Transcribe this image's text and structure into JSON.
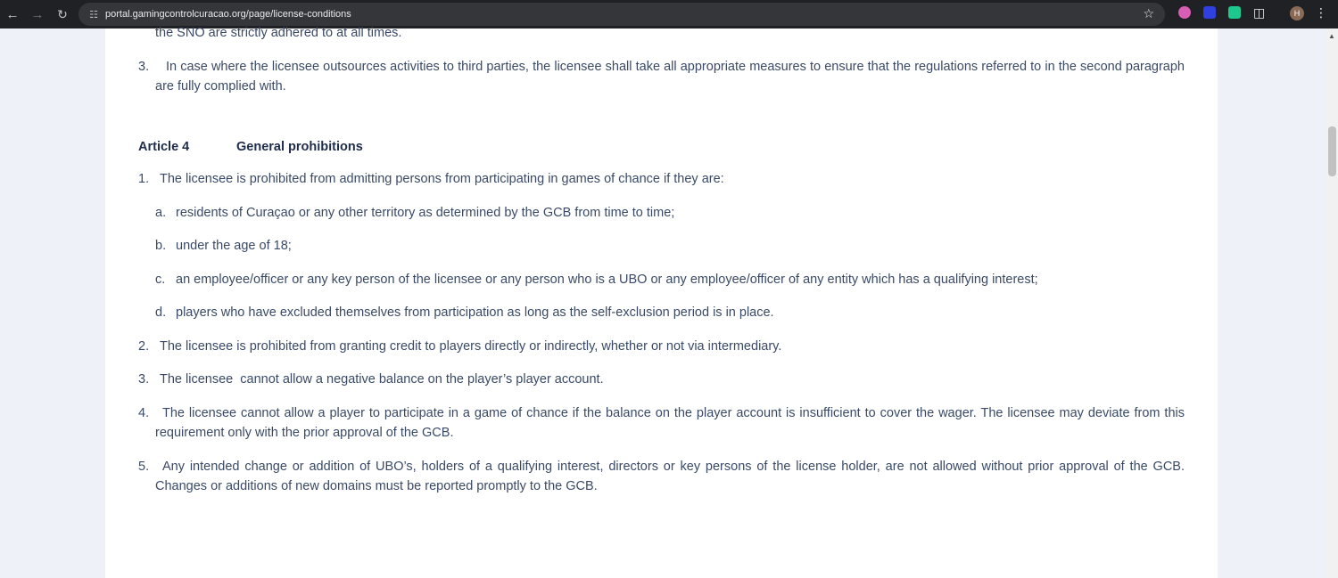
{
  "browser": {
    "url": "portal.gamingcontrolcuracao.org/page/license-conditions",
    "profile_initial": "H"
  },
  "content": {
    "prev_line": "the SNO are strictly adhered to at all times.",
    "prev_item": {
      "number": "3.",
      "text": "In case where the licensee outsources activities to third parties, the licensee shall take all appropriate measures to ensure that the regulations referred to in the second paragraph are fully complied with."
    },
    "article": {
      "number": "Article 4",
      "title": "General prohibitions"
    },
    "items": [
      {
        "number": "1.",
        "text": "The licensee is prohibited from admitting persons from participating in games of chance if they are:"
      },
      {
        "number": "2.",
        "text": "The licensee is prohibited from granting credit to players directly or indirectly, whether or not via intermediary."
      },
      {
        "number": "3.",
        "text": "The licensee  cannot allow a negative balance on the player’s player account."
      },
      {
        "number": "4.",
        "text": "The licensee cannot allow a player to participate in a game of chance if the balance on the player account is insufficient to cover the wager. The licensee may deviate from this requirement only with  the prior approval of the GCB."
      },
      {
        "number": "5.",
        "text": "Any intended change or addition of UBO’s, holders of a qualifying interest, directors or key persons of the license holder, are not allowed without prior approval of the GCB. Changes or additions of new domains must be reported promptly to the GCB."
      }
    ],
    "subitems": [
      {
        "letter": "a.",
        "text": "residents of Curaçao or any other territory as determined by the GCB from time to time;"
      },
      {
        "letter": "b.",
        "text": "under the age of 18;"
      },
      {
        "letter": "c.",
        "text": "an employee/officer or any key person of the licensee or any person who is a UBO or any employee/officer of any entity which has a qualifying interest;"
      },
      {
        "letter": "d.",
        "text": "players who have excluded themselves from participation as long as the self-exclusion period is in place."
      }
    ]
  },
  "colors": {
    "chrome": "#202124",
    "omnibox": "#35363a",
    "body_text": "#3a4a66",
    "heading": "#1f2d4d",
    "page_bg": "#eef2f8"
  }
}
